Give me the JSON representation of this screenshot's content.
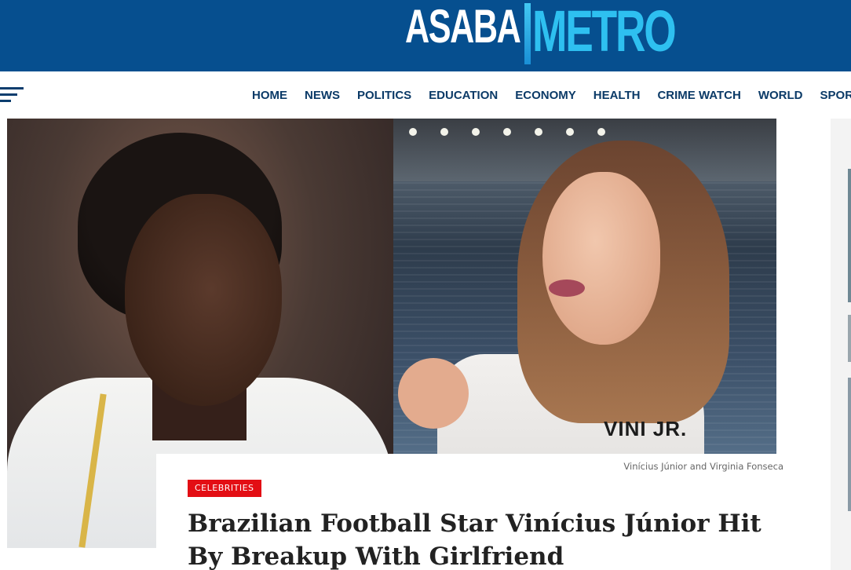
{
  "site": {
    "logo_part1": "ASABA",
    "logo_part2": "METRO"
  },
  "colors": {
    "header_bg": "#064f8f",
    "nav_text": "#0b3a67",
    "logo_accent": "#2ec0f0",
    "category_badge": "#e30e14"
  },
  "nav": {
    "menu_icon": "hamburger-menu-icon",
    "items": [
      "HOME",
      "NEWS",
      "POLITICS",
      "EDUCATION",
      "ECONOMY",
      "HEALTH",
      "CRIME WATCH",
      "WORLD",
      "SPORTS"
    ]
  },
  "article": {
    "image_caption": "Vinícius Júnior and Virginia Fonseca",
    "jersey_text": "VINI JR.",
    "category": "CELEBRITIES",
    "title": "Brazilian Football Star Vinícius Júnior Hit By Breakup With Girlfriend"
  }
}
